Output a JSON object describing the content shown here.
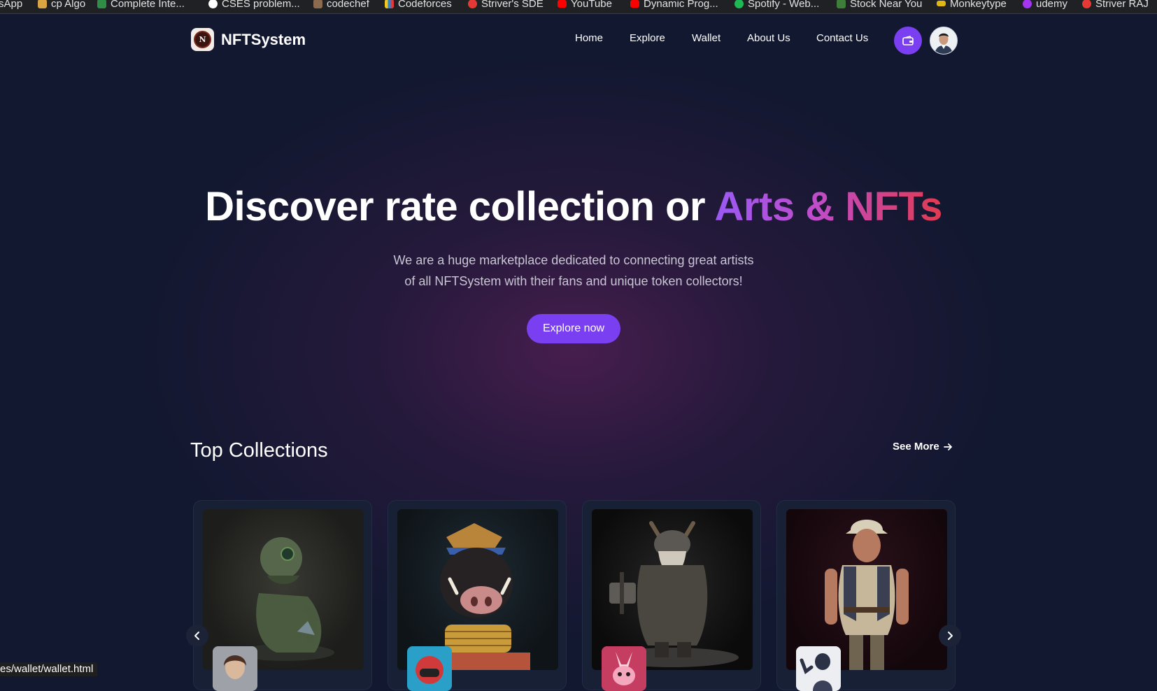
{
  "bookmarks": [
    {
      "label": "sApp",
      "color": "#25d366",
      "icon": "whatsapp-icon"
    },
    {
      "label": "cp Algo",
      "color": "#d9a441",
      "icon": "cp-algo-icon"
    },
    {
      "label": "Complete Inte...",
      "color": "#2f8d46",
      "icon": "gfg-icon"
    },
    {
      "label": "CSES problem...",
      "color": "#ffffff",
      "icon": "cses-icon"
    },
    {
      "label": "codechef",
      "color": "#8b6a4f",
      "icon": "codechef-icon"
    },
    {
      "label": "Codeforces",
      "color": "#f5c518",
      "icon": "codeforces-icon"
    },
    {
      "label": "Striver's SDE",
      "color": "#e53935",
      "icon": "takeuforward-icon"
    },
    {
      "label": "YouTube",
      "color": "#ff0000",
      "icon": "youtube-icon"
    },
    {
      "label": "Dynamic Prog...",
      "color": "#ff0000",
      "icon": "youtube-icon"
    },
    {
      "label": "Spotify - Web...",
      "color": "#1db954",
      "icon": "spotify-icon"
    },
    {
      "label": "Stock Near You",
      "color": "#3f7d3a",
      "icon": "stock-icon"
    },
    {
      "label": "Monkeytype",
      "color": "#e2b714",
      "icon": "monkeytype-icon"
    },
    {
      "label": "udemy",
      "color": "#a435f0",
      "icon": "udemy-icon"
    },
    {
      "label": "Striver RAJ",
      "color": "#e53935",
      "icon": "takeuforward-icon"
    }
  ],
  "brand": {
    "name": "NFTSystem",
    "logo_text": "N"
  },
  "nav": [
    "Home",
    "Explore",
    "Wallet",
    "About Us",
    "Contact Us"
  ],
  "hero": {
    "title_plain": "Discover rate collection or ",
    "title_highlight": "Arts & NFTs",
    "subtitle_line1": "We are a huge marketplace dedicated to connecting great artists",
    "subtitle_line2": "of all NFTSystem with their fans and unique token collectors!",
    "cta": "Explore now"
  },
  "collections": {
    "title": "Top Collections",
    "see_more": "See More",
    "items": [
      {
        "name": "robot-monkey-artwork"
      },
      {
        "name": "boar-warrior-artwork"
      },
      {
        "name": "dwarf-viking-artwork"
      },
      {
        "name": "adventurer-man-artwork"
      }
    ]
  },
  "status_url": "es/wallet/wallet.html",
  "colors": {
    "accent": "#7b3ff2",
    "background": "#121830",
    "card": "#182036"
  }
}
